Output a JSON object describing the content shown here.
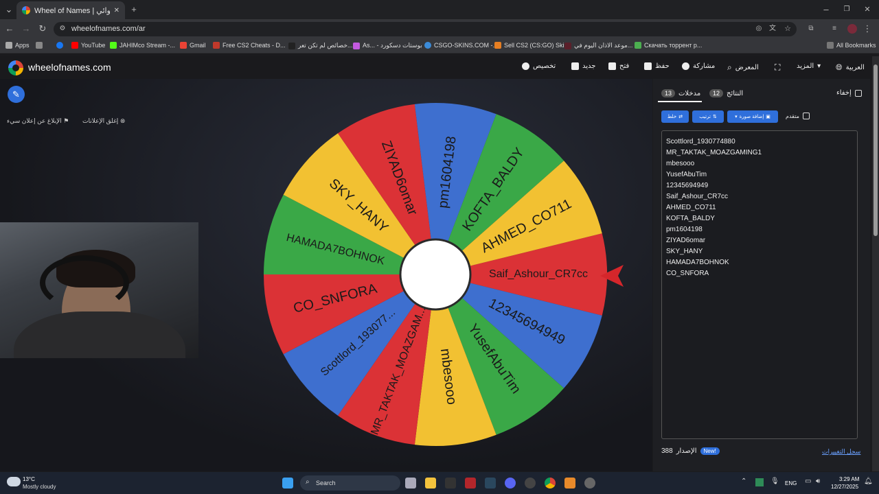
{
  "browser": {
    "tab_title": "Wheel of Names | اسم العشوائي",
    "url": "wheelofnames.com/ar",
    "bookmarks": [
      "Apps",
      "YouTube",
      "JAHIMco Stream -...",
      "Gmail",
      "Free CS2 Cheats - D...",
      "خصائص لم تكن تعر...",
      "As... - بوستات دسكورد",
      "CSGO-SKINS.COM -...",
      "Sell CS2 (CS:GO) Ski...",
      "موعد الاذان اليوم في...",
      "Скачать торрент р...",
      "All Bookmarks"
    ]
  },
  "site": {
    "brand": "wheelofnames.com",
    "nav": {
      "language": "العربية",
      "more": "المزيد",
      "gallery": "المعرض",
      "share": "مشاركة",
      "save": "حفظ",
      "open": "فتح",
      "new": "جديد",
      "customize": "تخصيص"
    },
    "close_ads": "إغلق الإعلانات",
    "report_ad": "الإبلاغ عن إعلان سيء"
  },
  "wheel": {
    "segments": [
      {
        "label": "Saif_Ashour_CR7cc",
        "color": "#db3236"
      },
      {
        "label": "12345694949",
        "color": "#3e6fcf"
      },
      {
        "label": "YusefAbuTim",
        "color": "#3aa847"
      },
      {
        "label": "mbesooo",
        "color": "#f2c132"
      },
      {
        "label": "MR_TAKTAK_MOAZGAM...",
        "color": "#db3236"
      },
      {
        "label": "Scottlord_193077...",
        "color": "#3e6fcf"
      },
      {
        "label": "CO_SNFORA",
        "color": "#db3236"
      },
      {
        "label": "HAMADA7BOHNOK",
        "color": "#3aa847"
      },
      {
        "label": "SKY_HANY",
        "color": "#f2c132"
      },
      {
        "label": "ZIYAD6omar",
        "color": "#db3236"
      },
      {
        "label": "pm1604198",
        "color": "#3e6fcf"
      },
      {
        "label": "KOFTA_BALDY",
        "color": "#3aa847"
      },
      {
        "label": "AHMED_CO711",
        "color": "#f2c132"
      }
    ],
    "pointer_color": "#d5262b"
  },
  "panel": {
    "hide_label": "إخفاء",
    "results_label": "النتائج",
    "results_count": "12",
    "entries_label": "مدخلات",
    "entries_count": "13",
    "advanced_label": "متقدم",
    "add_image_label": "إضافة صورة",
    "sort_label": "ترتيب",
    "shuffle_label": "خلط",
    "entries": [
      "Scottlord_1930774880",
      "MR_TAKTAK_MOAZGAMING1",
      "mbesooo",
      "YusefAbuTim",
      "12345694949",
      "Saif_Ashour_CR7cc",
      "AHMED_CO711",
      "KOFTA_BALDY",
      "pm1604198",
      "ZIYAD6omar",
      "SKY_HANY",
      "HAMADA7BOHNOK",
      "CO_SNFORA"
    ],
    "version_label": "الإصدار",
    "version_number": "388",
    "new_badge": "New!",
    "changelog": "سجل التغييرات"
  },
  "taskbar": {
    "temperature": "13°C",
    "weather": "Mostly cloudy",
    "search": "Search",
    "language": "ENG",
    "time": "3:29 AM",
    "date": "12/27/2025"
  }
}
